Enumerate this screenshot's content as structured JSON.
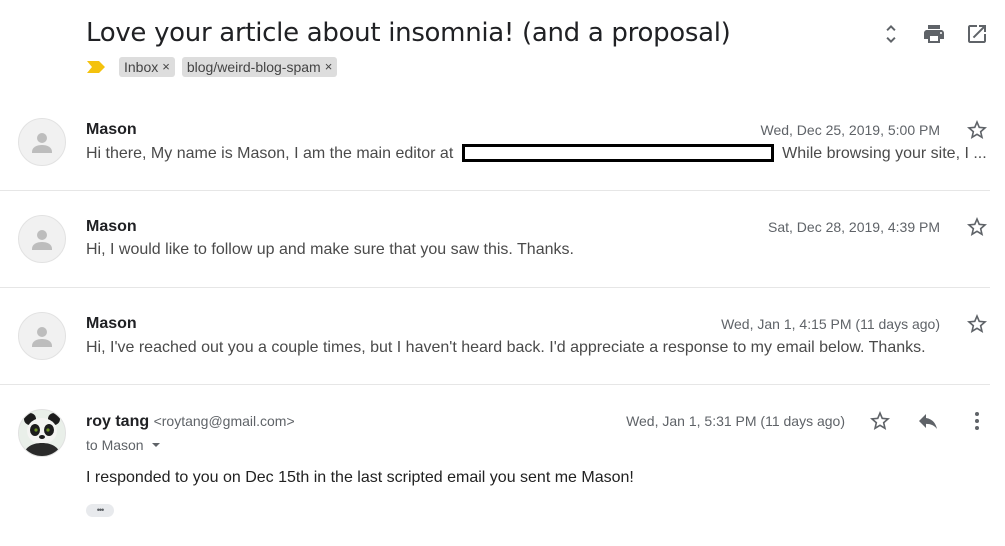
{
  "thread": {
    "subject": "Love your article about insomnia! (and a proposal)",
    "labels": [
      {
        "text": "Inbox",
        "remove": "×"
      },
      {
        "text": "blog/weird-blog-spam",
        "remove": "×"
      }
    ],
    "header_icons": [
      "expand-collapse-icon",
      "print-icon",
      "open-in-new-window-icon"
    ]
  },
  "messages": [
    {
      "sender": "Mason",
      "date": "Wed, Dec 25, 2019, 5:00 PM",
      "snippet_before": "Hi there, My name is Mason, I am the main editor at",
      "snippet_after": "While browsing your site, I ..."
    },
    {
      "sender": "Mason",
      "date": "Sat, Dec 28, 2019, 4:39 PM",
      "snippet": "Hi, I would like to follow up and make sure that you saw this. Thanks."
    },
    {
      "sender": "Mason",
      "date": "Wed, Jan 1, 4:15 PM (11 days ago)",
      "snippet": "Hi, I've reached out you a couple times, but I haven't heard back. I'd appreciate a response to my email below. Thanks."
    },
    {
      "sender": "roy tang",
      "sender_email": "<roytang@gmail.com>",
      "to": "to Mason",
      "date": "Wed, Jan 1, 5:31 PM (11 days ago)",
      "body": "I responded to you on Dec 15th in the last scripted email you sent me Mason!",
      "trimmed": "•••"
    }
  ],
  "colors": {
    "importance_marker": "#f4c20d",
    "chip_bg": "#dddddd",
    "icon_gray": "#5f6368"
  }
}
